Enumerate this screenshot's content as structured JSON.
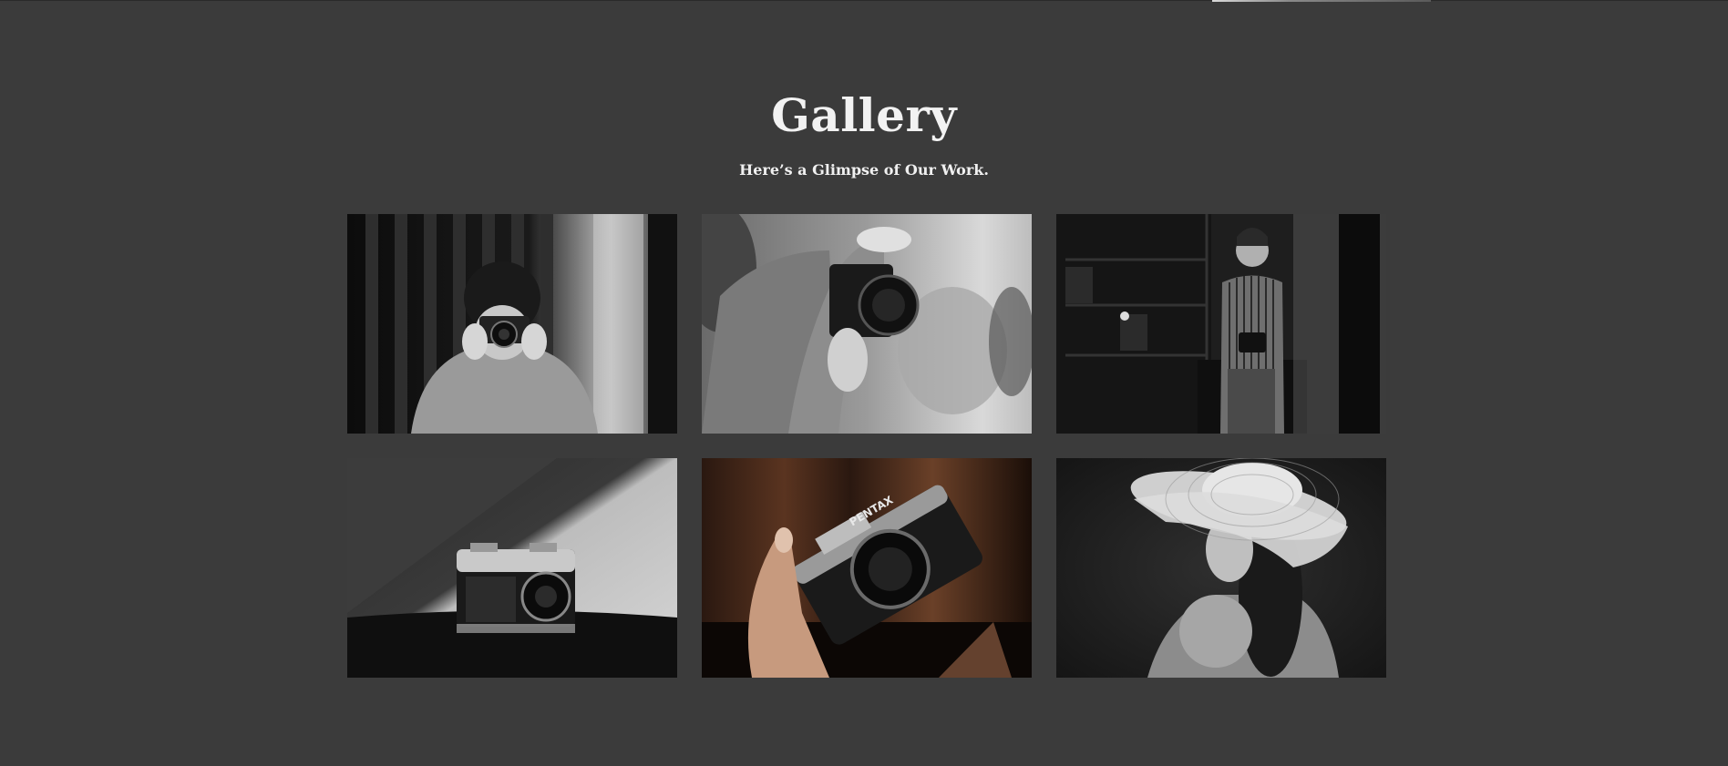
{
  "gallery": {
    "title": "Gallery",
    "subtitle": "Here’s a Glimpse of Our Work."
  },
  "photos": [
    {
      "subject": "person-photographing-mirror"
    },
    {
      "subject": "hands-holding-camera"
    },
    {
      "subject": "man-with-camera-in-studio"
    },
    {
      "subject": "vintage-camera-on-table"
    },
    {
      "subject": "hand-with-camera"
    },
    {
      "subject": "woman-in-sun-hat"
    }
  ],
  "camera_brand_label": "PENTAX",
  "colors": {
    "background": "#3b3b3b",
    "text": "#f2f2f2"
  }
}
